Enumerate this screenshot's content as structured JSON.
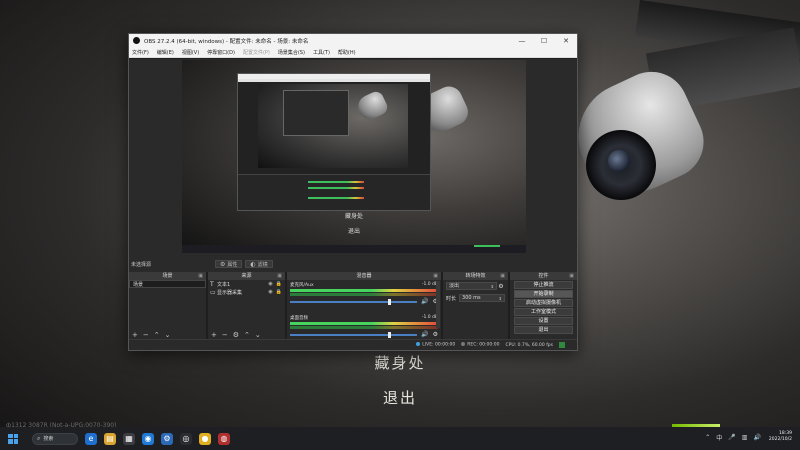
{
  "desktop": {
    "text_hide": "藏身处",
    "text_exit": "退出",
    "corner_text": "ф1312 3087R (Not-a-UPG:0070-390)"
  },
  "window": {
    "title": "OBS 27.2.4 (64-bit, windows) - 配置文件: 未命名 - 场景: 未命名",
    "controls": [
      "—",
      "☐",
      "✕"
    ]
  },
  "menu": [
    "文件(F)",
    "编辑(E)",
    "视图(V)",
    "停靠窗口(D)",
    "配置文件(P)",
    "场景集合(S)",
    "工具(T)",
    "帮助(H)"
  ],
  "menu_disabled_index": 4,
  "preview": {
    "text_hide": "藏身处",
    "text_exit": "退出"
  },
  "toolbar": {
    "no_source": "未选择源",
    "properties": "属性",
    "filters": "滤镜"
  },
  "docks": {
    "scenes": {
      "title": "场景",
      "items": [
        "场景"
      ]
    },
    "sources": {
      "title": "来源",
      "items": [
        {
          "icon": "text-icon",
          "label": "文本1"
        },
        {
          "icon": "monitor-icon",
          "label": "显示器采集"
        }
      ]
    },
    "mixer": {
      "title": "混音器",
      "channels": [
        {
          "name": "麦克风/Aux",
          "db": "-1.0 dB"
        },
        {
          "name": "桌面音频",
          "db": "-1.0 dB"
        }
      ]
    },
    "transitions": {
      "title": "转场特效",
      "type": "淡出",
      "duration_label": "时长",
      "duration_value": "300 ms"
    },
    "controls": {
      "title": "控件",
      "buttons": [
        "停止推流",
        "开始录制",
        "启动虚拟摄像机",
        "工作室模式",
        "设置",
        "退出"
      ]
    }
  },
  "status": {
    "live": "LIVE: 00:00:00",
    "rec": "REC: 00:00:00",
    "cpu": "CPU: 0.7%, 60.00 fps"
  },
  "taskbar": {
    "search": "搜索",
    "tray_lang": "中",
    "time": "18:39",
    "date": "2022/10/2"
  },
  "colors": {
    "accent_green": "#46d45e",
    "meter_blue": "#4b7fc4",
    "windows_blue": "#4aa3ea"
  }
}
